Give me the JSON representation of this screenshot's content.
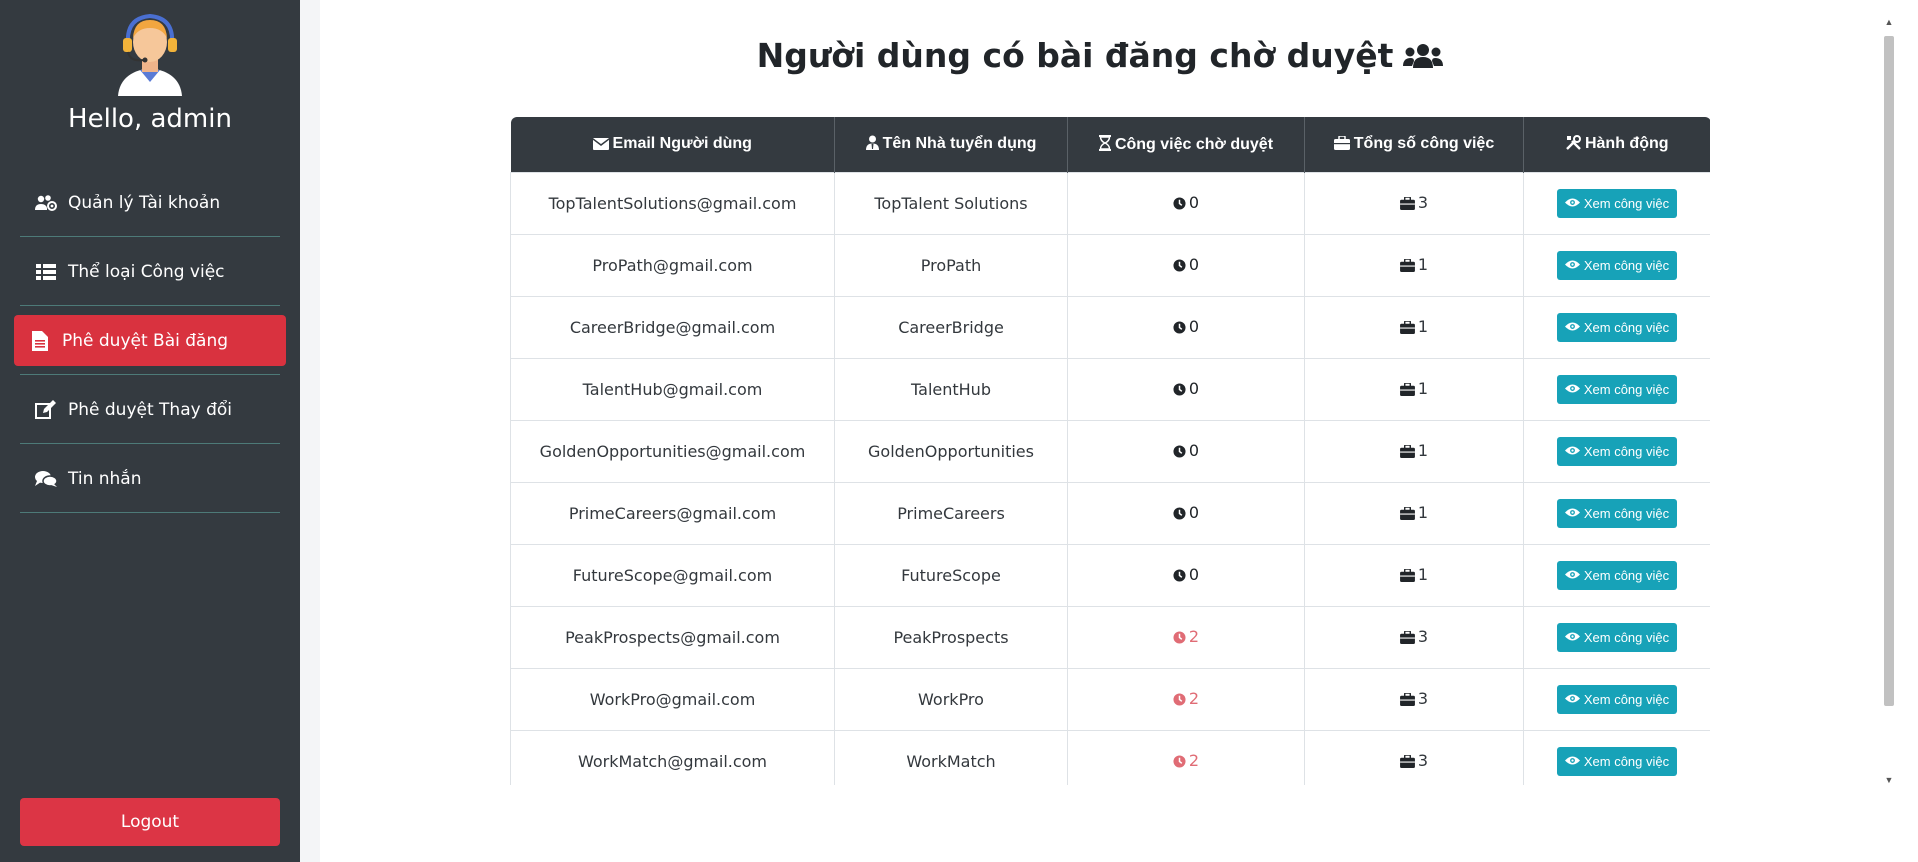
{
  "sidebar": {
    "greeting": "Hello, admin",
    "items": [
      {
        "label": "Quản lý Tài khoản",
        "icon": "users-cog-icon",
        "active": false
      },
      {
        "label": "Thể loại Công việc",
        "icon": "list-icon",
        "active": false
      },
      {
        "label": "Phê duyệt Bài đăng",
        "icon": "file-icon",
        "active": true
      },
      {
        "label": "Phê duyệt Thay đổi",
        "icon": "edit-icon",
        "active": false
      },
      {
        "label": "Tin nhắn",
        "icon": "comments-icon",
        "active": false
      }
    ],
    "logout_label": "Logout"
  },
  "main": {
    "title": "Người dùng có bài đăng chờ duyệt",
    "table": {
      "headers": [
        "Email Người dùng",
        "Tên Nhà tuyển dụng",
        "Công việc chờ duyệt",
        "Tổng số công việc",
        "Hành động"
      ],
      "action_label": "Xem công việc",
      "rows": [
        {
          "email": "TopTalentSolutions@gmail.com",
          "name": "TopTalent Solutions",
          "pending": "0",
          "total": "3"
        },
        {
          "email": "ProPath@gmail.com",
          "name": "ProPath",
          "pending": "0",
          "total": "1"
        },
        {
          "email": "CareerBridge@gmail.com",
          "name": "CareerBridge",
          "pending": "0",
          "total": "1"
        },
        {
          "email": "TalentHub@gmail.com",
          "name": "TalentHub",
          "pending": "0",
          "total": "1"
        },
        {
          "email": "GoldenOpportunities@gmail.com",
          "name": "GoldenOpportunities",
          "pending": "0",
          "total": "1"
        },
        {
          "email": "PrimeCareers@gmail.com",
          "name": "PrimeCareers",
          "pending": "0",
          "total": "1"
        },
        {
          "email": "FutureScope@gmail.com",
          "name": "FutureScope",
          "pending": "0",
          "total": "1"
        },
        {
          "email": "PeakProspects@gmail.com",
          "name": "PeakProspects",
          "pending": "2",
          "total": "3"
        },
        {
          "email": "WorkPro@gmail.com",
          "name": "WorkPro",
          "pending": "2",
          "total": "3"
        },
        {
          "email": "WorkMatch@gmail.com",
          "name": "WorkMatch",
          "pending": "2",
          "total": "3"
        }
      ]
    }
  },
  "colors": {
    "sidebar_bg": "#343a40",
    "active_item": "#d9323f",
    "logout": "#dc3545",
    "action_button": "#17a2b8",
    "pending_warning": "#e06c75"
  }
}
